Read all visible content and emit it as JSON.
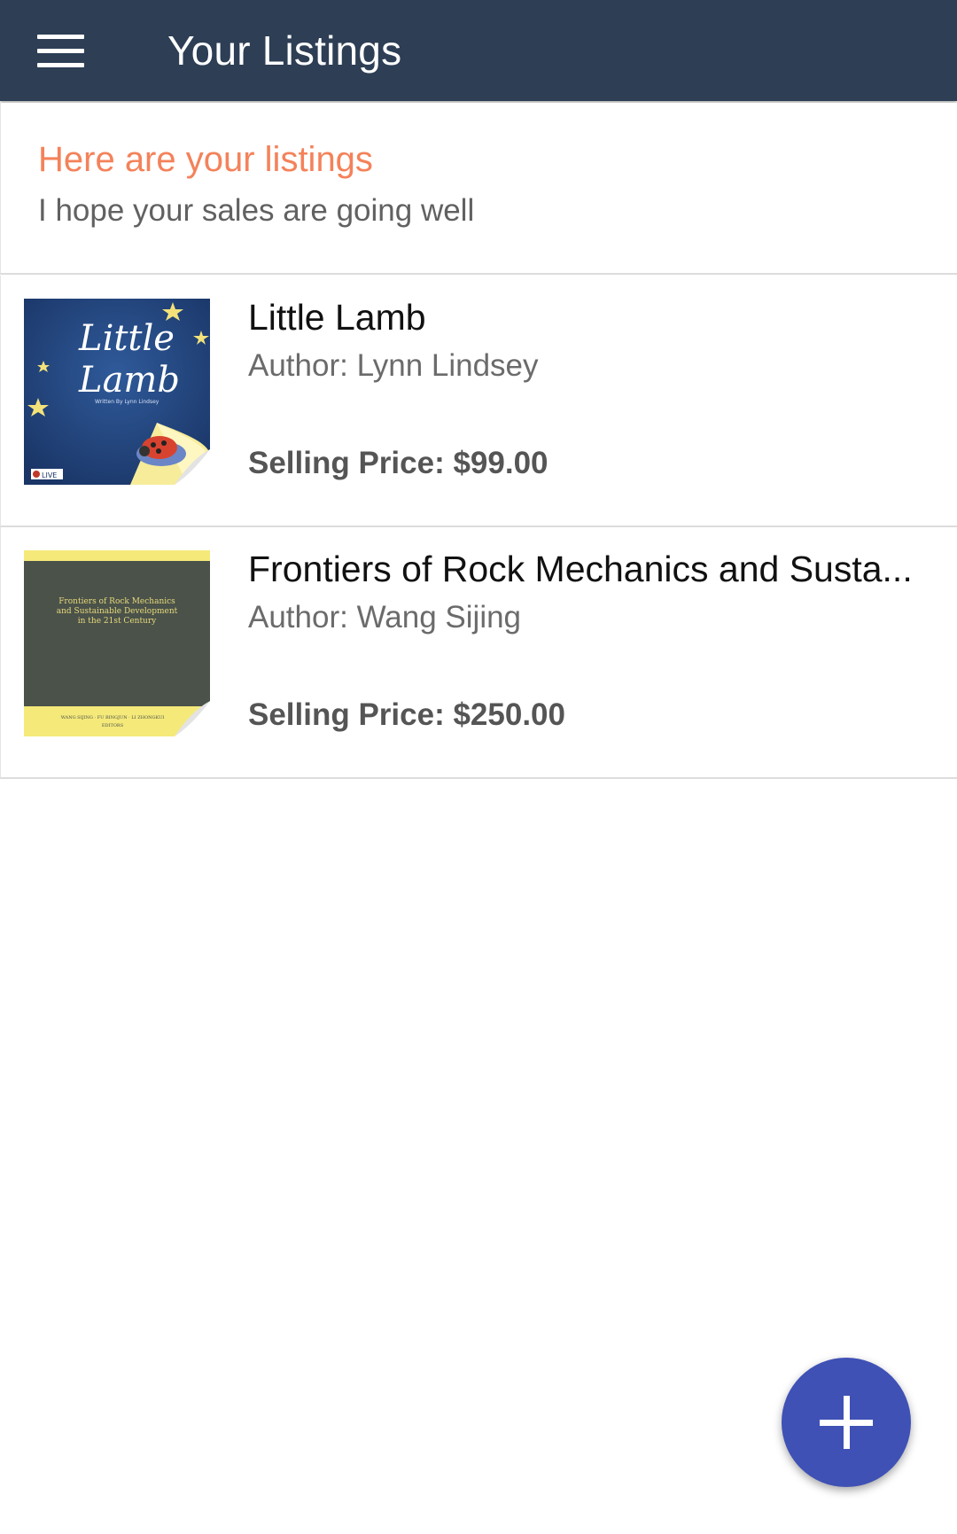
{
  "toolbar": {
    "menu_icon": "hamburger-menu-icon",
    "title": "Your Listings",
    "background": "#2d3e55"
  },
  "header": {
    "title": "Here are your listings",
    "subtitle": "I hope your sales are going well",
    "title_color": "#f4825a"
  },
  "listings": [
    {
      "title": "Little Lamb",
      "author": "Author: Lynn Lindsey",
      "price": "Selling Price: $99.00",
      "cover": {
        "line1": "Little",
        "line2": "Lamb",
        "byline": "Written By Lynn Lindsey",
        "publisher": "LIVE"
      }
    },
    {
      "title": "Frontiers of Rock Mechanics and Susta...",
      "author": "Author: Wang Sijing",
      "price": "Selling Price: $250.00",
      "cover": {
        "line1": "Frontiers of Rock Mechanics",
        "line2": "and Sustainable Development",
        "line3": "in the 21st Century",
        "editors": "WANG SIJING · FU BINGJUN · LI ZHONGKUI",
        "editors_label": "EDITORS"
      }
    }
  ],
  "fab": {
    "icon": "plus-icon",
    "color": "#3f51b5"
  }
}
